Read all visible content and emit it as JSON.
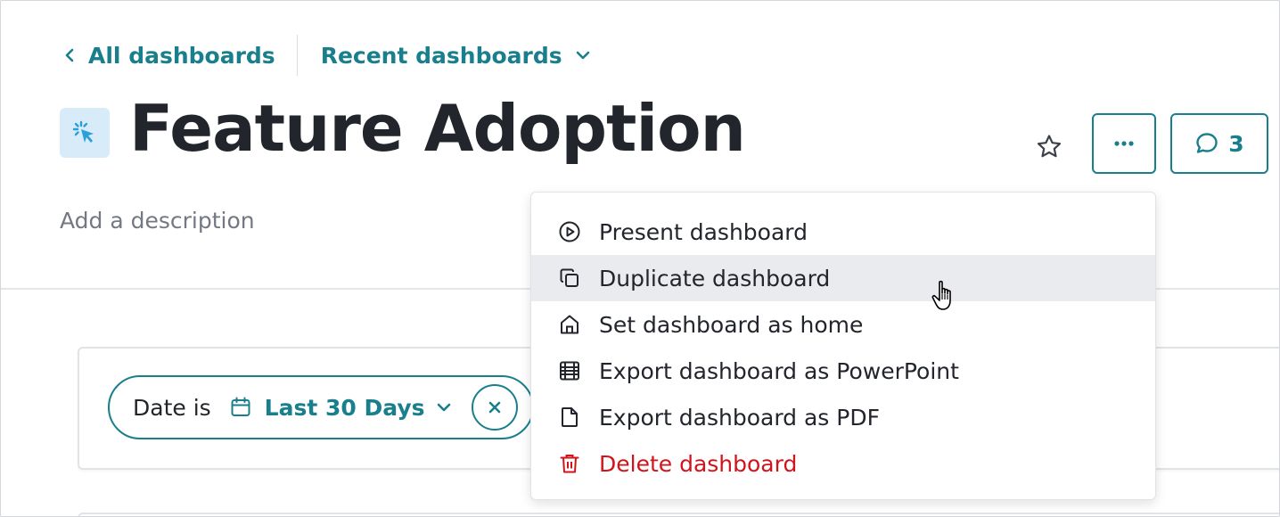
{
  "breadcrumb": {
    "back_label": "All dashboards",
    "recent_label": "Recent dashboards"
  },
  "page": {
    "title": "Feature Adoption",
    "title_icon": "cursor-click-icon",
    "description_placeholder": "Add a description"
  },
  "actions": {
    "star_icon": "star-icon",
    "more_icon": "more-horizontal-icon",
    "comments_count": "3",
    "comments_icon": "comment-icon"
  },
  "menu": {
    "items": [
      {
        "label": "Present dashboard",
        "icon": "play-circle-icon"
      },
      {
        "label": "Duplicate dashboard",
        "icon": "copy-icon",
        "hovered": true
      },
      {
        "label": "Set dashboard as home",
        "icon": "home-icon"
      },
      {
        "label": "Export dashboard as PowerPoint",
        "icon": "film-icon"
      },
      {
        "label": "Export dashboard as PDF",
        "icon": "file-icon"
      },
      {
        "label": "Delete dashboard",
        "icon": "trash-icon",
        "danger": true
      }
    ]
  },
  "filter": {
    "label": "Date is",
    "value": "Last 30 Days"
  },
  "colors": {
    "accent": "#1a7f8c",
    "danger": "#d1141b",
    "text": "#22252b",
    "muted": "#737883",
    "hover": "#eaebef"
  }
}
